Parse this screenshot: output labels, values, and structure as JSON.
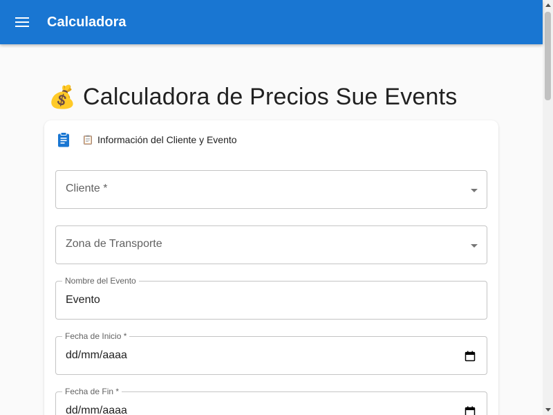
{
  "appbar": {
    "title": "Calculadora"
  },
  "page": {
    "emoji": "💰",
    "title": "Calculadora de Precios Sue Events"
  },
  "card": {
    "small_emoji": "📋",
    "title": "Información del Cliente y Evento",
    "fields": {
      "cliente": {
        "label": "Cliente *"
      },
      "zona": {
        "label": "Zona de Transporte"
      },
      "nombre": {
        "label": "Nombre del Evento",
        "value": "Evento"
      },
      "fecha_inicio": {
        "label": "Fecha de Inicio *",
        "value": "dd/mm/aaaa"
      },
      "fecha_fin": {
        "label": "Fecha de Fin *",
        "value": "dd/mm/aaaa"
      }
    }
  },
  "colors": {
    "primary": "#1976d2",
    "background": "#fafafa",
    "border": "#c4c4c4"
  }
}
